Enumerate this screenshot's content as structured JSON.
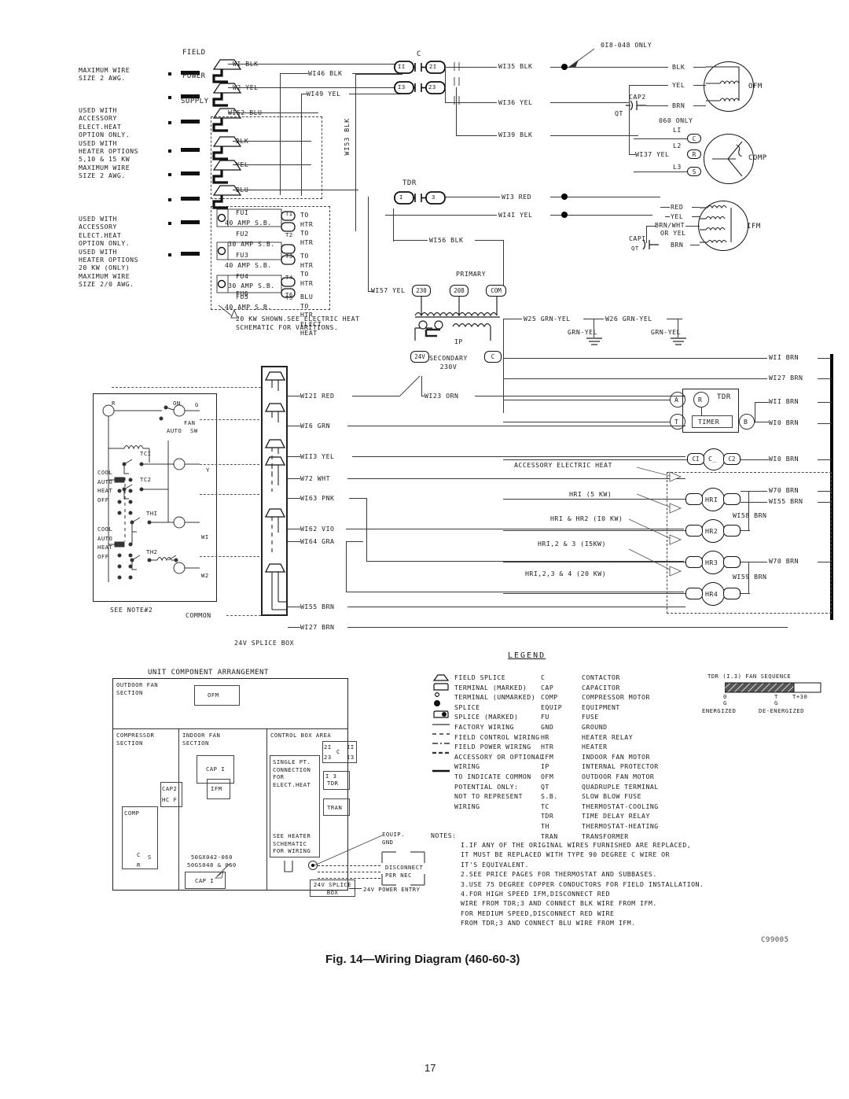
{
  "page": {
    "number": "17",
    "drawing_code": "C99005"
  },
  "figure": {
    "caption": "Fig. 14—Wiring Diagram (460-60-3)"
  },
  "left_notes": [
    {
      "id": "note-max-wire-2awg",
      "lines": [
        "MAXIMUM WIRE",
        "SIZE 2 AWG."
      ]
    },
    {
      "id": "note-accessory-5-10-15kw",
      "lines": [
        "USED WITH",
        "ACCESSORY",
        "ELECT.HEAT",
        "OPTION ONLY.",
        "USED WITH",
        "HEATER OPTIONS",
        "5,10 & 15 KW",
        "MAXIMUM WIRE",
        "SIZE 2 AWG."
      ]
    },
    {
      "id": "note-accessory-20kw",
      "lines": [
        "USED WITH",
        "ACCESSORY",
        "ELECT.HEAT",
        "OPTION ONLY.",
        "USED WITH",
        "HEATER OPTIONS",
        "20 KW (ONLY)",
        "MAXIMUM WIRE",
        "SIZE 2/0 AWG."
      ]
    }
  ],
  "supply_terminals": [
    {
      "label": "FIELD",
      "wire": "WI BLK"
    },
    {
      "label": "POWER",
      "wire": "W2 YEL"
    },
    {
      "label": "SUPPLY",
      "wire": "WI52 BLU"
    },
    {
      "label": "",
      "wire": "BLK"
    },
    {
      "label": "",
      "wire": "YEL"
    },
    {
      "label": "",
      "wire": "BLU"
    }
  ],
  "fuse_block": {
    "rows": [
      {
        "fuse": "FUI",
        "terminal": "TI",
        "rating": "40 AMP S.B.",
        "to": [
          "TO",
          "HTR"
        ]
      },
      {
        "fuse": "FU2",
        "terminal": "T2",
        "rating": "30 AMP S.B.",
        "to": [
          "TO",
          "HTR"
        ]
      },
      {
        "fuse": "FU3",
        "terminal": "T3",
        "rating": "40 AMP S.B.",
        "to": [
          "TO",
          "HTR"
        ]
      },
      {
        "fuse": "FU4",
        "terminal": "T4",
        "rating": "30 AMP S.B.",
        "to": [
          "TO",
          "HTR"
        ]
      },
      {
        "fuse": "FU5",
        "terminal": "T5",
        "rating": "40 AMP S.B.",
        "to": [
          "BLU",
          "TO"
        ]
      },
      {
        "fuse": "FU6",
        "terminal": "T6",
        "rating": "30 AMP S.B.",
        "to": [
          "HTR",
          "ELECT",
          "HEAT"
        ]
      }
    ],
    "callout": [
      "20 KW SHOWN.SEE ELECTRIC HEAT",
      "SCHEMATIC FOR VARITIONS."
    ]
  },
  "contactor": {
    "name": "C",
    "terminals": [
      [
        "II",
        "2I"
      ],
      [
        "I3",
        "23"
      ]
    ],
    "out_wires": [
      "WI35 BLK",
      "WI36 YEL",
      "WI39 BLK"
    ],
    "bus_label": "WI53 BLK"
  },
  "tdr_contact": {
    "name": "TDR",
    "terminals": [
      "I",
      "3"
    ],
    "out_wires": [
      "WI3 RED",
      "WI4I YEL"
    ]
  },
  "mid_wires": [
    "WI46 BLK",
    "WI49 YEL",
    "WI56 BLK",
    "WI57 YEL"
  ],
  "transformer": {
    "primary_label": "PRIMARY",
    "primary_taps": [
      "230",
      "208",
      "COM"
    ],
    "secondary_label": [
      "SECONDARY",
      "230V"
    ],
    "secondary_taps": [
      "24V",
      "C"
    ],
    "internal_protector": "IP"
  },
  "grounds": {
    "wires": [
      "W25 GRN-YEL",
      "W26 GRN-YEL"
    ],
    "tap_labels": [
      "GRN-YEL",
      "GRN-YEL"
    ]
  },
  "motors": {
    "ofm": {
      "name": "OFM",
      "note": "0I8-048 ONLY",
      "leads": [
        "BLK",
        "YEL",
        "BRN"
      ],
      "cap": "CAP2",
      "qt": "QT"
    },
    "comp": {
      "name": "COMP",
      "note": "060 ONLY",
      "lines": [
        "LI",
        "L2",
        "L3"
      ],
      "terminals": [
        "C",
        "R",
        "S"
      ],
      "wire": "WI37 YEL"
    },
    "ifm": {
      "name": "IFM",
      "leads": [
        "RED",
        "YEL",
        "BRN/WHT",
        "OR YEL",
        "BRN"
      ],
      "cap": "CAPI",
      "qt": "QT"
    }
  },
  "thermostat": {
    "caption": "SEE NOTE#2",
    "terminals": [
      "R",
      "G",
      "Y",
      "WI",
      "W2"
    ],
    "switch_labels": [
      "ON",
      "FAN",
      "AUTO",
      "SW"
    ],
    "mode_sets": [
      [
        "COOL",
        "AUTO",
        "HEAT",
        "OFF"
      ],
      [
        "COOL",
        "AUTO",
        "HEAT",
        "OFF"
      ]
    ],
    "devices": [
      "TCI",
      "TC2",
      "THI",
      "TH2"
    ]
  },
  "splice_box": {
    "title": "24V SPLICE BOX",
    "common_label": "COMMON",
    "wires_left": [
      "WI2I RED",
      "WI6 GRN",
      "WII3 YEL",
      "W72 WHT",
      "WI63 PNK",
      "WI62 VIO",
      "WI64 GRA",
      "WI55 BRN",
      "WI27 BRN"
    ],
    "orn_wire": "WI23 ORN"
  },
  "right_bus": {
    "wires": [
      "WII BRN",
      "WI27 BRN",
      "WII BRN",
      "WI0 BRN",
      "WI0 BRN",
      "W70 BRN",
      "WI55 BRN",
      "W70 BRN"
    ],
    "inner_wires": [
      "WI58 BRN",
      "WI59 BRN"
    ]
  },
  "tdr_relay": {
    "name": "TDR",
    "terminals": [
      "A",
      "R",
      "T",
      "B"
    ],
    "body": "TIMER"
  },
  "contactor_c": {
    "terminals": [
      "CI",
      "C2"
    ],
    "name": "C_"
  },
  "heaters": {
    "header": "ACCESSORY ELECTRIC HEAT",
    "relays": [
      {
        "name": "HRI",
        "label": "HRI   (5 KW)"
      },
      {
        "name": "HR2",
        "label": "HRI & HR2  (I0 KW)"
      },
      {
        "name": "HR3",
        "label": "HRI,2 & 3  (I5KW)"
      },
      {
        "name": "HR4",
        "label": "HRI,2,3 & 4  (20 KW)"
      }
    ]
  },
  "unit_arrangement": {
    "title": "UNIT COMPONENT ARRANGEMENT",
    "sections": [
      {
        "name": "outdoor-fan-section",
        "lines": [
          "OUTDOOR FAN",
          "SECTION"
        ]
      },
      {
        "name": "compressor-section",
        "lines": [
          "COMPRESSOR",
          "SECTION"
        ]
      },
      {
        "name": "indoor-fan-section",
        "lines": [
          "INDOOR FAN",
          "SECTION"
        ]
      },
      {
        "name": "control-box-area",
        "lines": [
          "CONTROL BOX AREA"
        ]
      }
    ],
    "boxes": {
      "ofm": "OFM",
      "cap1_top": "CAP I",
      "ifm": "IFM",
      "cap2": "CAP2",
      "hcf": "HC F",
      "comp": "COMP",
      "comp_terms": [
        "C",
        "S",
        "R"
      ],
      "cap1_bottom": "CAP I",
      "model_lines": [
        "50GX042-060",
        "50GS048 & 060"
      ],
      "single_pt": [
        "SINGLE PT.",
        "CONNECTION",
        "FOR",
        "ELECT.HEAT"
      ],
      "see_heater": [
        "SEE HEATER",
        "SCHEMATIC",
        "FOR WIRING"
      ],
      "contactor_terms": [
        "2I",
        "II",
        "C",
        "23",
        "I3"
      ],
      "tdr": [
        "I  3",
        "TDR"
      ],
      "tran": "TRAN",
      "equip_gnd": [
        "EQUIP.",
        "GND"
      ],
      "disconnect": [
        "DISCONNECT",
        "PER NEC"
      ],
      "splice_box": [
        "24V SPLICE",
        "BOX"
      ],
      "power_entry": "24V POWER ENTRY"
    }
  },
  "legend": {
    "title": "LEGEND",
    "symbols": [
      {
        "glyph": "field-splice-icon",
        "text": "FIELD SPLICE"
      },
      {
        "glyph": "terminal-marked-icon",
        "text": "TERMINAL (MARKED)"
      },
      {
        "glyph": "terminal-unmarked-icon",
        "text": "TERMINAL (UNMARKED)"
      },
      {
        "glyph": "splice-icon",
        "text": "SPLICE"
      },
      {
        "glyph": "splice-marked-icon",
        "text": "SPLICE (MARKED)"
      },
      {
        "glyph": "solid-line-icon",
        "text": "FACTORY WIRING"
      },
      {
        "glyph": "dashed-line-icon",
        "text": "FIELD CONTROL WIRING"
      },
      {
        "glyph": "dashdot-line-icon",
        "text": "FIELD POWER WIRING"
      },
      {
        "glyph": "dashdashdot-line-icon",
        "text": "ACCESSORY OR OPTIONAL"
      },
      {
        "glyph": "",
        "text": "WIRING"
      },
      {
        "glyph": "heavy-line-icon",
        "text": "TO INDICATE COMMON"
      },
      {
        "glyph": "",
        "text": "POTENTIAL ONLY:"
      },
      {
        "glyph": "",
        "text": "NOT TO REPRESENT"
      },
      {
        "glyph": "",
        "text": "WIRING"
      }
    ],
    "abbreviations": [
      {
        "abbr": "C",
        "meaning": "CONTACTOR"
      },
      {
        "abbr": "CAP",
        "meaning": "CAPACITOR"
      },
      {
        "abbr": "COMP",
        "meaning": "COMPRESSOR MOTOR"
      },
      {
        "abbr": "EQUIP",
        "meaning": "EQUIPMENT"
      },
      {
        "abbr": "FU",
        "meaning": "FUSE"
      },
      {
        "abbr": "GND",
        "meaning": "GROUND"
      },
      {
        "abbr": "HR",
        "meaning": "HEATER RELAY"
      },
      {
        "abbr": "HTR",
        "meaning": "HEATER"
      },
      {
        "abbr": "IFM",
        "meaning": "INDOOR FAN MOTOR"
      },
      {
        "abbr": "IP",
        "meaning": "INTERNAL PROTECTOR"
      },
      {
        "abbr": "OFM",
        "meaning": "OUTDOOR FAN MOTOR"
      },
      {
        "abbr": "QT",
        "meaning": "QUADRUPLE TERMINAL"
      },
      {
        "abbr": "S.B.",
        "meaning": "SLOW BLOW FUSE"
      },
      {
        "abbr": "TC",
        "meaning": "THERMOSTAT-COOLING"
      },
      {
        "abbr": "TDR",
        "meaning": "TIME DELAY RELAY"
      },
      {
        "abbr": "TH",
        "meaning": "THERMOSTAT-HEATING"
      },
      {
        "abbr": "TRAN",
        "meaning": "TRANSFORMER"
      }
    ]
  },
  "fan_sequence": {
    "title": "TDR (I.3)   FAN SEQUENCE",
    "ticks": [
      "0",
      "T",
      "T+30"
    ],
    "sub_labels": [
      "G",
      "G"
    ],
    "states": [
      "ENERGIZED",
      "DE-ENERGIZED"
    ]
  },
  "notes": {
    "title": "NOTES:",
    "items": [
      [
        "I.IF ANY OF THE ORIGINAL WIRES FURNISHED ARE REPLACED,",
        "  IT MUST BE REPLACED WITH TYPE 90 DEGREE C WIRE OR",
        "  IT'S EQUIVALENT."
      ],
      [
        "2.SEE PRICE PAGES FOR THERMOSTAT AND SUBBASES."
      ],
      [
        "3.USE 75 DEGREE COPPER CONDUCTORS FOR FIELD INSTALLATION."
      ],
      [
        " 4.FOR HIGH SPEED IFM,DISCONNECT RED",
        "   WIRE FROM TDR;3 AND CONNECT BLK WIRE FROM IFM.",
        "   FOR MEDIUM SPEED,DISCONNECT RED WIRE",
        "   FROM TDR;3 AND CONNECT BLU WIRE FROM IFM."
      ]
    ]
  },
  "colors": {
    "ink": "#1a1a1a",
    "line": "#3a3a3a",
    "heavy": "#000000"
  }
}
